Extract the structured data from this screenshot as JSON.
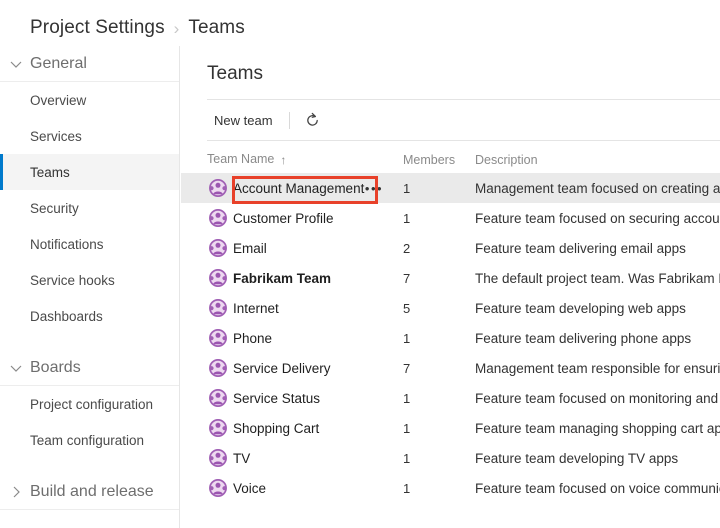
{
  "breadcrumb": {
    "items": [
      "Project Settings",
      "Teams"
    ],
    "separator": "›"
  },
  "sidebar": {
    "groups": [
      {
        "label": "General",
        "chevron": "chevron-down",
        "items": [
          {
            "label": "Overview",
            "selected": false
          },
          {
            "label": "Services",
            "selected": false
          },
          {
            "label": "Teams",
            "selected": true
          },
          {
            "label": "Security",
            "selected": false
          },
          {
            "label": "Notifications",
            "selected": false
          },
          {
            "label": "Service hooks",
            "selected": false
          },
          {
            "label": "Dashboards",
            "selected": false
          }
        ]
      },
      {
        "label": "Boards",
        "chevron": "chevron-down",
        "items": [
          {
            "label": "Project configuration",
            "selected": false
          },
          {
            "label": "Team configuration",
            "selected": false
          }
        ]
      },
      {
        "label": "Build and release",
        "chevron": "chevron-right",
        "items": []
      }
    ]
  },
  "main": {
    "title": "Teams",
    "toolbar": {
      "new_team_label": "New team",
      "refresh_icon": "refresh-icon"
    },
    "table": {
      "columns": {
        "name": "Team Name",
        "name_sort": "↑",
        "members": "Members",
        "description": "Description"
      },
      "rows": [
        {
          "name": "Account Management",
          "members": "1",
          "description": "Management team focused on creating and managing accounts",
          "bold": false,
          "selected": true,
          "dots": "•••"
        },
        {
          "name": "Customer Profile",
          "members": "1",
          "description": "Feature team focused on securing accounts",
          "bold": false,
          "selected": false,
          "dots": ""
        },
        {
          "name": "Email",
          "members": "2",
          "description": "Feature team delivering email apps",
          "bold": false,
          "selected": false,
          "dots": ""
        },
        {
          "name": "Fabrikam Team",
          "members": "7",
          "description": "The default project team. Was Fabrikam Fiber Team",
          "bold": true,
          "selected": false,
          "dots": ""
        },
        {
          "name": "Internet",
          "members": "5",
          "description": "Feature team developing web apps",
          "bold": false,
          "selected": false,
          "dots": ""
        },
        {
          "name": "Phone",
          "members": "1",
          "description": "Feature team delivering phone apps",
          "bold": false,
          "selected": false,
          "dots": ""
        },
        {
          "name": "Service Delivery",
          "members": "7",
          "description": "Management team responsible for ensuring service delivery",
          "bold": false,
          "selected": false,
          "dots": ""
        },
        {
          "name": "Service Status",
          "members": "1",
          "description": "Feature team focused on monitoring and alerts",
          "bold": false,
          "selected": false,
          "dots": ""
        },
        {
          "name": "Shopping Cart",
          "members": "1",
          "description": "Feature team managing shopping cart apps",
          "bold": false,
          "selected": false,
          "dots": ""
        },
        {
          "name": "TV",
          "members": "1",
          "description": "Feature team developing TV apps",
          "bold": false,
          "selected": false,
          "dots": ""
        },
        {
          "name": "Voice",
          "members": "1",
          "description": "Feature team focused on voice communication apps",
          "bold": false,
          "selected": false,
          "dots": ""
        }
      ]
    }
  },
  "annotation": {
    "target": "Account Management",
    "color": "#e8412a"
  },
  "colors": {
    "accent": "#007acc",
    "annotation": "#e8412a",
    "selected_row_bg": "#eaeaea",
    "avatar_ring": "#a05fb4",
    "avatar_fill": "#edd9f0"
  }
}
